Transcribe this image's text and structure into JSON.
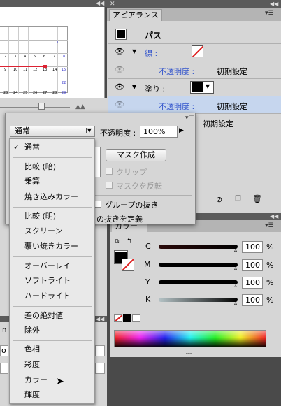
{
  "appearance": {
    "title": "アピアランス",
    "heading": "パス",
    "stroke_label": "線 :",
    "opacity_label": "不透明度 :",
    "opacity_value": "初期設定",
    "fill_label": "塗り :",
    "opacity2_label": "不透明度 :",
    "opacity2_value": "初期設定"
  },
  "transparency": {
    "blend_mode": "通常",
    "opacity_label": "不透明度 :",
    "opacity_value": "100%",
    "fill_default": "初期設定",
    "make_mask": "マスク作成",
    "clip": "クリップ",
    "invert_mask": "マスクを反転",
    "knockout_group": "グループの抜き",
    "define_knockout": "の抜きを定義"
  },
  "color": {
    "title": "カラー",
    "channels": [
      {
        "label": "C",
        "value": "100",
        "unit": "%"
      },
      {
        "label": "M",
        "value": "100",
        "unit": "%"
      },
      {
        "label": "Y",
        "value": "100",
        "unit": "%"
      },
      {
        "label": "K",
        "value": "100",
        "unit": "%"
      }
    ]
  },
  "blend_menu": {
    "checkmark": "✓",
    "items": [
      "通常",
      "比較 (暗)",
      "乗算",
      "焼き込みカラー",
      "比較 (明)",
      "スクリーン",
      "覆い焼きカラー",
      "オーバーレイ",
      "ソフトライト",
      "ハードライト",
      "差の絶対値",
      "除外",
      "色相",
      "彩度",
      "カラー",
      "輝度"
    ]
  },
  "calendar": {
    "rows": [
      [
        "",
        "",
        "",
        "",
        "",
        "1"
      ],
      [
        "2",
        "3",
        "4",
        "5",
        "6",
        "7",
        "8"
      ],
      [
        "9",
        "10",
        "11",
        "12",
        "13",
        "14",
        "15"
      ],
      [
        "",
        "",
        "",
        "",
        "",
        "",
        "22"
      ],
      [
        "23",
        "24",
        "25",
        "26",
        "27",
        "28",
        "29"
      ]
    ]
  },
  "left_bottom": {
    "text_n": "n",
    "text_o": "o"
  },
  "colors": {
    "menu_bg": "#e9e9e9",
    "panel_bg": "#d6d6d6",
    "highlight": "#c6d6ee",
    "link_blue": "#3355cc"
  }
}
